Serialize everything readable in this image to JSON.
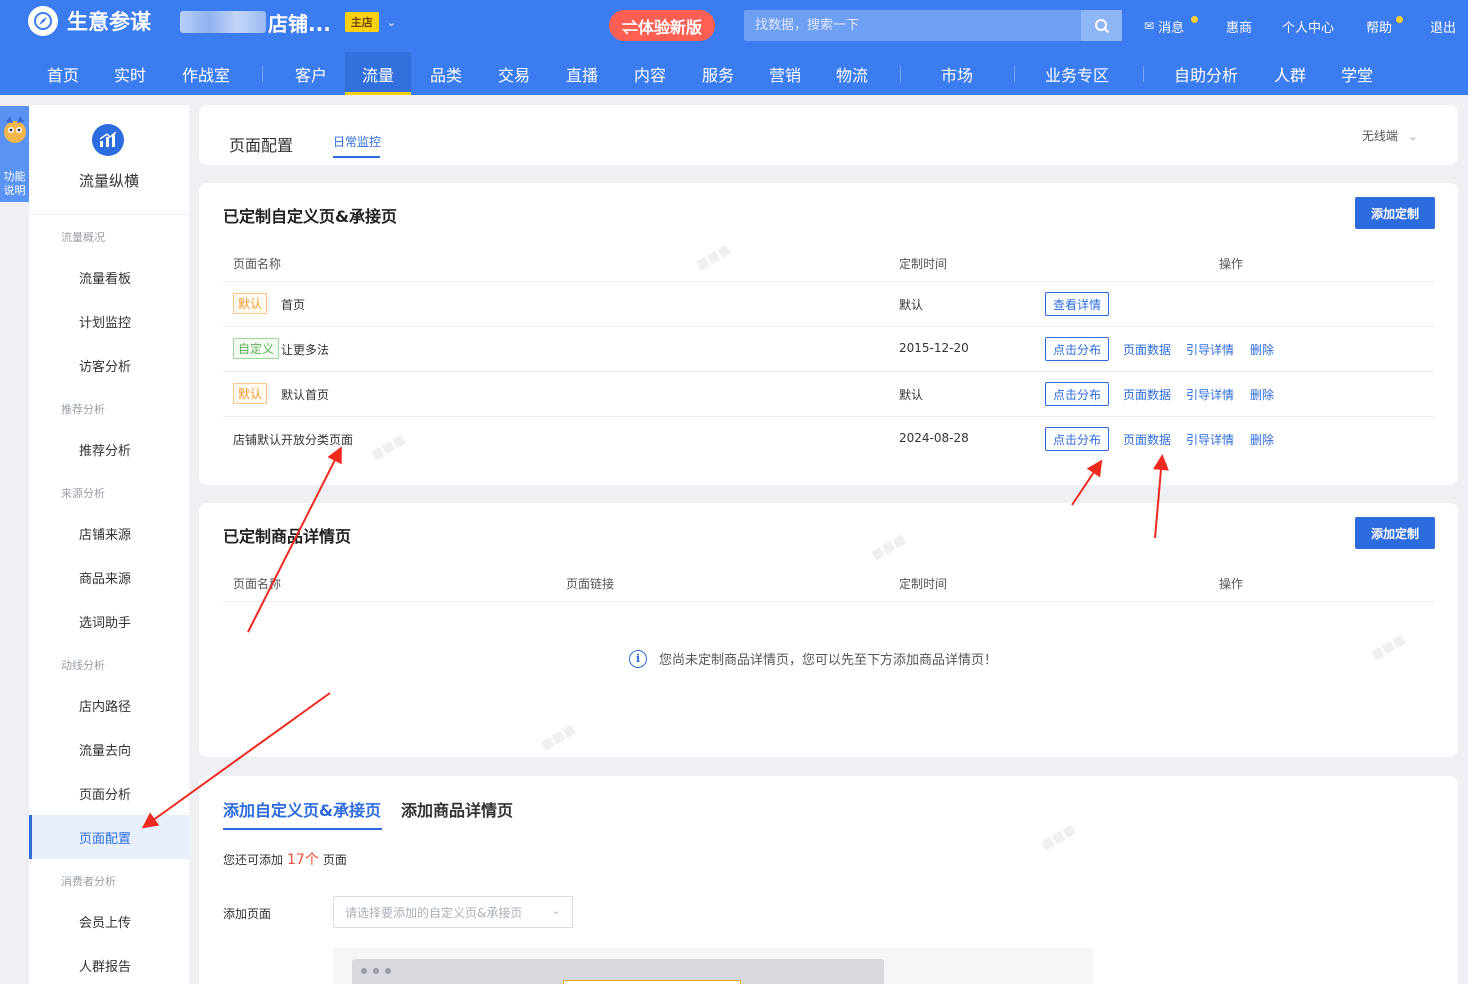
{
  "app": {
    "title": "生意参谋",
    "shop_name": "店铺...",
    "shop_badge": "主店"
  },
  "header": {
    "trial_button": "⇌体验新版",
    "search_placeholder": "找数据，搜索一下",
    "utilities": [
      "消息",
      "惠商",
      "个人中心",
      "帮助",
      "退出"
    ]
  },
  "nav": {
    "items": [
      "首页",
      "实时",
      "作战室",
      "客户",
      "流量",
      "品类",
      "交易",
      "直播",
      "内容",
      "服务",
      "营销",
      "物流",
      "市场",
      "业务专区",
      "自助分析",
      "人群",
      "学堂"
    ],
    "active": "流量"
  },
  "float_help": "功能说明",
  "sidebar": {
    "title": "流量纵横",
    "groups": [
      "流量概况",
      "推荐分析",
      "来源分析",
      "动线分析",
      "消费者分析"
    ],
    "items": [
      "流量看板",
      "计划监控",
      "访客分析",
      "推荐分析",
      "店铺来源",
      "商品来源",
      "选词助手",
      "店内路径",
      "流量去向",
      "页面分析",
      "页面配置",
      "会员上传",
      "人群报告"
    ],
    "active": "页面配置"
  },
  "page_tabs": {
    "tab1": "页面配置",
    "tab2": "日常监控",
    "device": "无线端"
  },
  "custom_pages": {
    "title": "已定制自定义页&承接页",
    "add_button": "添加定制",
    "headers": {
      "name": "页面名称",
      "time": "定制时间",
      "ops": "操作"
    },
    "rows": [
      {
        "tag": "默认",
        "name": "首页",
        "time": "默认",
        "primary": "查看详情"
      },
      {
        "tag": "自定义",
        "name": "让更多法",
        "time": "2015-12-20",
        "primary": "点击分布",
        "links": [
          "页面数据",
          "引导详情",
          "删除"
        ]
      },
      {
        "tag": "默认",
        "name": "默认首页",
        "time": "默认",
        "primary": "点击分布",
        "links": [
          "页面数据",
          "引导详情",
          "删除"
        ]
      },
      {
        "tag": "",
        "name": "店铺默认开放分类页面",
        "time": "2024-08-28",
        "primary": "点击分布",
        "links": [
          "页面数据",
          "引导详情",
          "删除"
        ]
      }
    ]
  },
  "product_pages": {
    "title": "已定制商品详情页",
    "add_button": "添加定制",
    "headers": {
      "name": "页面名称",
      "link": "页面链接",
      "time": "定制时间",
      "ops": "操作"
    },
    "empty_text": "您尚未定制商品详情页，您可以先至下方添加商品详情页！"
  },
  "add_section": {
    "tab_a": "添加自定义页&承接页",
    "tab_b": "添加商品详情页",
    "remain_prefix": "您还可添加",
    "remain_count": "17个",
    "remain_suffix": "页面",
    "add_label": "添加页面",
    "select_placeholder": "请选择要添加的自定义页&承接页"
  },
  "colors": {
    "brand": "#3b7cf0",
    "primary": "#2d6cdf",
    "accent_red": "#f0533a",
    "arrow": "#ee2a1f"
  }
}
